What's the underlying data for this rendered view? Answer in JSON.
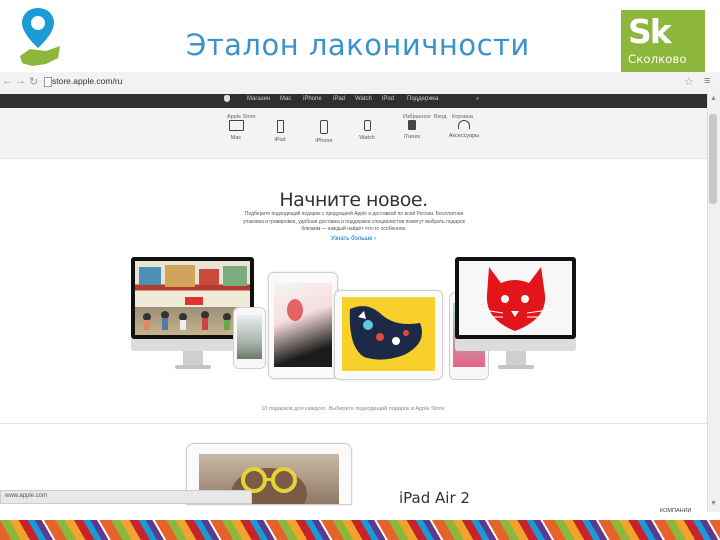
{
  "slide": {
    "title": "Эталон лаконичности",
    "logo_right_mark": "Sk",
    "logo_right_name": "Сколково"
  },
  "browser": {
    "url": "store.apple.com/ru",
    "status_url": "www.apple.com",
    "scroll_up": "▲",
    "scroll_down": "▼"
  },
  "navbar": {
    "items": [
      "Магазин",
      "Mac",
      "iPhone",
      "iPad",
      "Watch",
      "iPod",
      "Поддержка"
    ],
    "search_glyph": "⌕"
  },
  "subheader": {
    "left_label": "Apple Store",
    "right_items": [
      "Избранное",
      "Вход",
      "Корзина"
    ],
    "categories": [
      "Mac",
      "iPod",
      "iPhone",
      "Watch",
      "iTunes",
      "Аксессуары"
    ]
  },
  "hero": {
    "title": "Начните новое.",
    "text": "Подберите подходящий подарок с продукцией Apple и доставкой по всей России. Бесплатная упаковка и гравировка, удобная доставка и поддержка специалистов помогут выбрать подарок близким — каждый найдёт что-то особенное.",
    "link": "Узнать больше ›"
  },
  "footnote": "10 подарков для каждого. Выберите подходящий подарок в Apple Store.",
  "ipad_section": {
    "title": "iPad Air 2"
  },
  "page_footer": {
    "label": "КОМПАНИИ"
  },
  "colors": {
    "slide_title": "#3b93c9",
    "skolkovo_green": "#8cb63c",
    "apple_nav": "#2f2f2f",
    "link_blue": "#0070c9",
    "cat_red": "#e4141b"
  }
}
